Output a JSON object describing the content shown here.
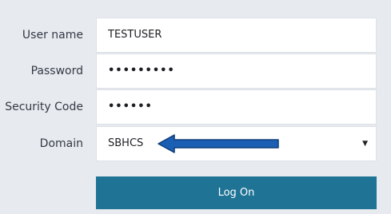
{
  "form": {
    "username": {
      "label": "User name",
      "value": "TESTUSER"
    },
    "password": {
      "label": "Password",
      "value": "•••••••••"
    },
    "security_code": {
      "label": "Security Code",
      "value": "••••••"
    },
    "domain": {
      "label": "Domain",
      "selected": "SBHCS",
      "caret": "▼"
    },
    "logon_label": "Log On"
  },
  "colors": {
    "background": "#e7eaef",
    "button": "#1f7395",
    "arrow": "#1a5fb4"
  },
  "icons": {
    "annotation_arrow": "left-arrow-icon"
  }
}
